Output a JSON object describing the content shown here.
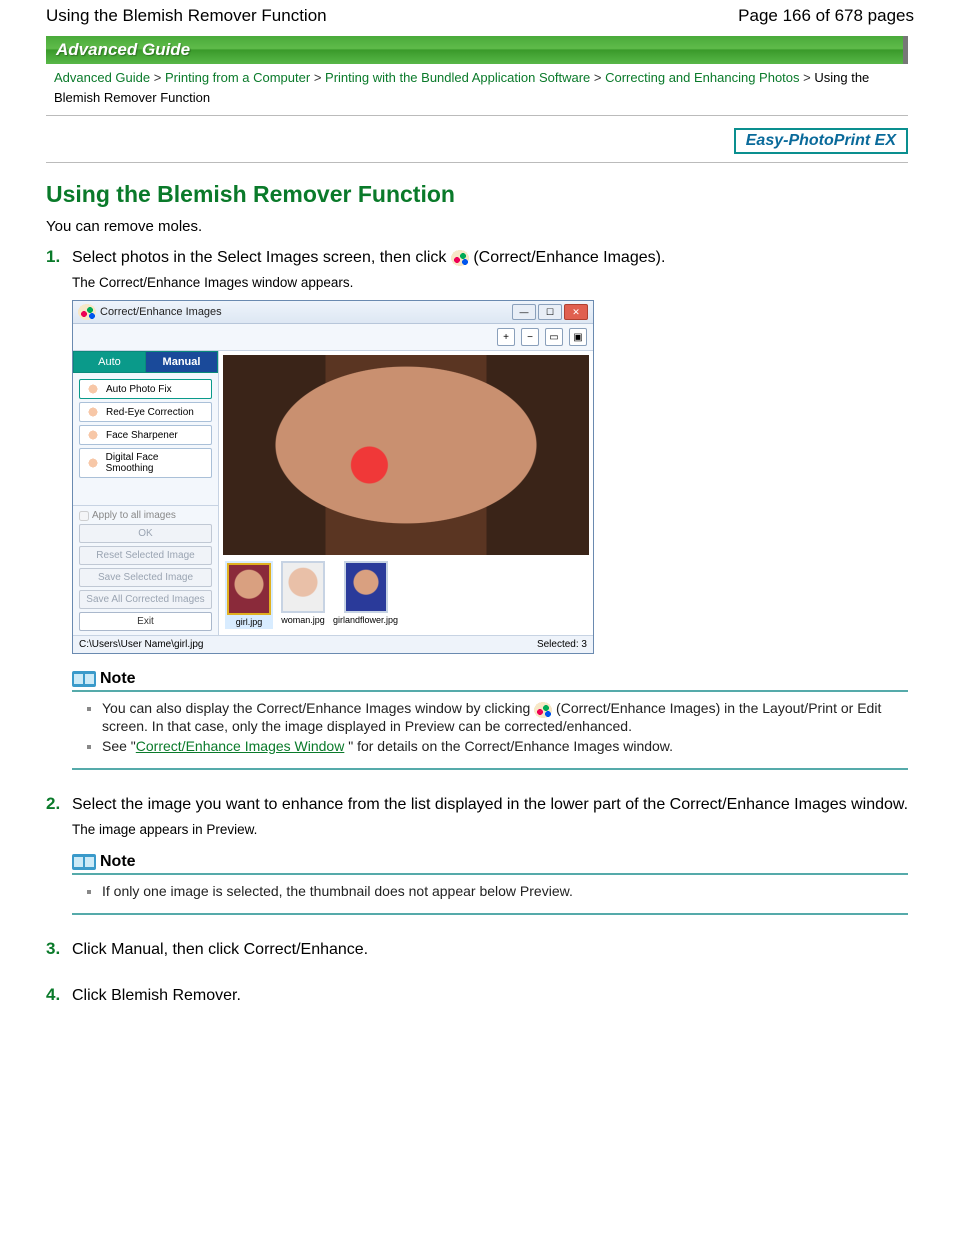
{
  "header": {
    "title": "Using the Blemish Remover Function",
    "page_indicator": "Page 166 of 678 pages"
  },
  "guide_bar": "Advanced Guide",
  "breadcrumb": {
    "items": [
      "Advanced Guide",
      "Printing from a Computer",
      "Printing with the Bundled Application Software",
      "Correcting and Enhancing Photos"
    ],
    "current": "Using the Blemish Remover Function",
    "sep": ">"
  },
  "product_badge": "Easy-PhotoPrint EX",
  "main_heading": "Using the Blemish Remover Function",
  "intro": "You can remove moles.",
  "steps": [
    {
      "num": "1.",
      "title_before": "Select photos in the Select Images screen, then click ",
      "title_after": " (Correct/Enhance Images).",
      "sub": "The Correct/Enhance Images window appears."
    },
    {
      "num": "2.",
      "title": "Select the image you want to enhance from the list displayed in the lower part of the Correct/Enhance Images window.",
      "sub": "The image appears in Preview."
    },
    {
      "num": "3.",
      "title": "Click Manual, then click Correct/Enhance."
    },
    {
      "num": "4.",
      "title": "Click Blemish Remover."
    }
  ],
  "note1": {
    "label": "Note",
    "items_pre": "You can also display the Correct/Enhance Images window by clicking ",
    "items_post": " (Correct/Enhance Images) in the Layout/Print or Edit screen. In that case, only the image displayed in Preview can be corrected/enhanced.",
    "see_pre": "See \"",
    "see_link": "Correct/Enhance Images Window",
    "see_post": " \" for details on the Correct/Enhance Images window."
  },
  "note2": {
    "label": "Note",
    "item": "If only one image is selected, the thumbnail does not appear below Preview."
  },
  "app": {
    "title": "Correct/Enhance Images",
    "tabs": {
      "auto": "Auto",
      "manual": "Manual"
    },
    "tools": [
      "Auto Photo Fix",
      "Red-Eye Correction",
      "Face Sharpener",
      "Digital Face Smoothing"
    ],
    "apply_all": "Apply to all images",
    "buttons": {
      "ok": "OK",
      "reset": "Reset Selected Image",
      "save_sel": "Save Selected Image",
      "save_all": "Save All Corrected Images",
      "exit": "Exit"
    },
    "thumbs": [
      "girl.jpg",
      "woman.jpg",
      "girlandflower.jpg"
    ],
    "status_path": "C:\\Users\\User Name\\girl.jpg",
    "status_sel": "Selected: 3"
  }
}
